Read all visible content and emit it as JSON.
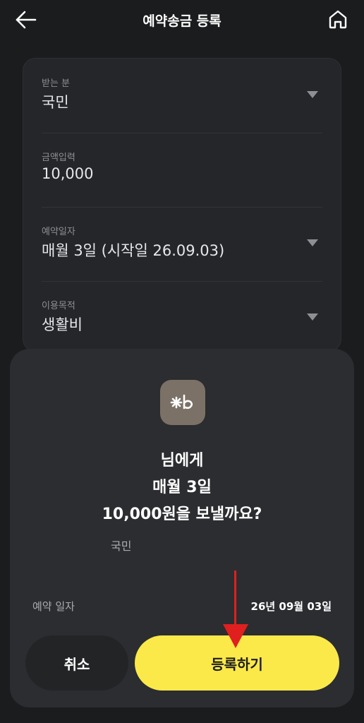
{
  "header": {
    "title": "예약송금 등록",
    "back_icon": "back-arrow-icon",
    "home_icon": "home-icon"
  },
  "form": {
    "recipient": {
      "label": "받는 분",
      "value": "국민"
    },
    "amount": {
      "label": "금액입력",
      "value": "10,000"
    },
    "schedule": {
      "label": "예약일자",
      "value": "매월 3일 (시작일 26.09.03)"
    },
    "purpose": {
      "label": "이용목적",
      "value": "생활비"
    }
  },
  "sheet": {
    "bank_logo_icon": "kb-bank-logo-icon",
    "message_line1": "님에게",
    "message_line2": "매월 3일",
    "message_line3": "10,000원을 보낼까요?",
    "recipient_bank": "국민",
    "date_label": "예약 일자",
    "date_value": "26년 09월 03일",
    "cancel_label": "취소",
    "submit_label": "등록하기"
  },
  "colors": {
    "background": "#1b1c1e",
    "card": "#252629",
    "sheet": "#2b2d30",
    "accent_yellow": "#fbe94a",
    "annotation_red": "#e01f1f"
  }
}
